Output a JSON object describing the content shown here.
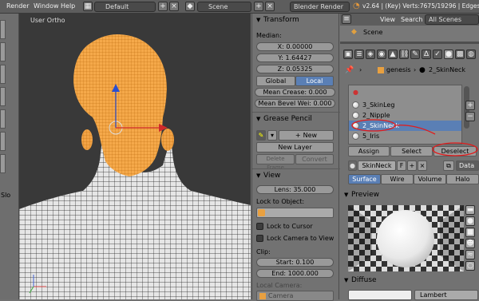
{
  "menu": {
    "render": "Render",
    "window": "Window",
    "help": "Help"
  },
  "header": {
    "layout": "Default",
    "scene": "Scene",
    "engine": "Blender Render",
    "stats": "v2.64 | (Key) Verts:7675/19296 | Edges:1"
  },
  "viewport": {
    "label": "User Ortho"
  },
  "left_strip": {
    "label": "Slo"
  },
  "transform": {
    "title": "Transform",
    "median": "Median:",
    "x": "X: 0.00000",
    "y": "Y: 1.64427",
    "z": "Z: 0.05325",
    "global": "Global",
    "local": "Local",
    "crease": "Mean Crease: 0.000",
    "bevel": "Mean Bevel Wei: 0.000"
  },
  "grease": {
    "title": "Grease Pencil",
    "new": "New",
    "new_layer": "New Layer",
    "delete_frame": "Delete Frame",
    "convert": "Convert"
  },
  "view": {
    "title": "View",
    "lens": "Lens: 35.000",
    "lock_object": "Lock to Object:",
    "lock_cursor": "Lock to Cursor",
    "lock_camera": "Lock Camera to View",
    "clip": "Clip:",
    "start": "Start: 0.100",
    "end": "End: 1000.000",
    "local_camera": "Local Camera:",
    "camera": "Camera"
  },
  "outliner": {
    "view": "View",
    "search": "Search",
    "filter": "All Scenes",
    "scene": "Scene"
  },
  "breadcrumb": {
    "obj": "genesis",
    "mat": "2_SkinNeck"
  },
  "materials": {
    "items": [
      "3_SkinLeg",
      "2_Nipple",
      "2_SkinNeck",
      "5_Iris"
    ],
    "selected_index": 2,
    "assign": "Assign",
    "select": "Select",
    "deselect": "Deselect"
  },
  "material_field": {
    "name": "SkinNeck",
    "f": "F",
    "data": "Data"
  },
  "mat_tabs": [
    "Surface",
    "Wire",
    "Volume",
    "Halo"
  ],
  "preview": {
    "title": "Preview"
  },
  "diffuse": {
    "title": "Diffuse",
    "shader": "Lambert"
  },
  "colors": {
    "accent": "#5a7fb5",
    "annotation": "#e21b1b",
    "mesh": "#f59a22"
  }
}
